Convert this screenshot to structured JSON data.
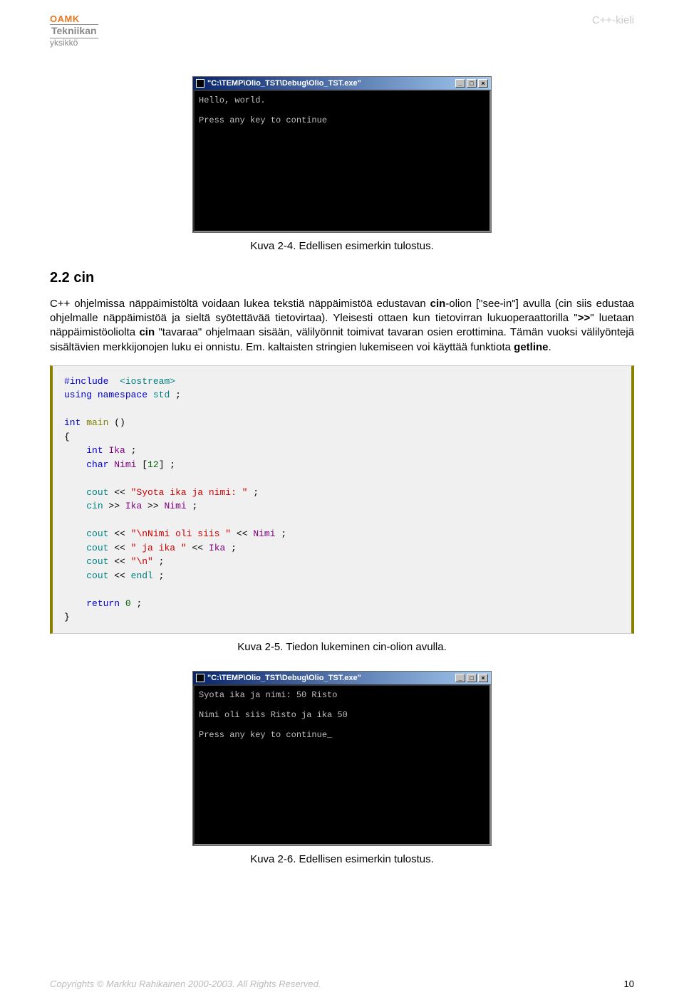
{
  "header": {
    "logo_top": "OAMK",
    "logo_mid": "Tekniikan",
    "logo_bot": "yksikkö",
    "page_label": "C++-kieli"
  },
  "console1": {
    "title": "\"C:\\TEMP\\Olio_TST\\Debug\\Olio_TST.exe\"",
    "line1": "Hello, world.",
    "line2": "Press any key to continue"
  },
  "caption1": "Kuva 2-4. Edellisen esimerkin tulostus.",
  "section_heading": "2.2 cin",
  "paragraph": {
    "p1a": "C++ ohjelmissa näppäimistöltä voidaan lukea tekstiä näppäimistöä edustavan ",
    "p1b": "cin",
    "p1c": "-olion [\"see-in\"] avulla (cin siis edustaa ohjelmalle näppäimistöä ja sieltä syötettävää tietovirtaa). Yleisesti ottaen kun tietovirran lukuoperaattorilla \"",
    "p1d": ">>",
    "p1e": "\" luetaan näppäimistöoliolta ",
    "p1f": "cin",
    "p1g": " \"tavaraa\" ohjelmaan sisään, välilyönnit toimivat tavaran osien erottimina. Tämän vuoksi välilyöntejä sisältävien merkkijonojen luku ei onnistu. Em. kaltaisten stringien lukemiseen voi käyttää funktiota ",
    "p1h": "getline",
    "p1i": "."
  },
  "code": {
    "l1a": "#include",
    "l1b": "<iostream>",
    "l2a": "using",
    "l2b": "namespace",
    "l2c": "std",
    "l3a": "int",
    "l3b": "main",
    "l4a": "int",
    "l4b": "Ika",
    "l5a": "char",
    "l5b": "Nimi",
    "l5c": "12",
    "l6a": "cout",
    "l6b": "\"Syota ika ja nimi: \"",
    "l7a": "cin",
    "l7b": "Ika",
    "l7c": "Nimi",
    "l8a": "cout",
    "l8b": "\"\\nNimi oli siis \"",
    "l8c": "Nimi",
    "l9a": "cout",
    "l9b": "\" ja ika \"",
    "l9c": "Ika",
    "l10a": "cout",
    "l10b": "\"\\n\"",
    "l11a": "cout",
    "l11b": "endl",
    "l12a": "return",
    "l12b": "0"
  },
  "caption2": "Kuva 2-5. Tiedon lukeminen cin-olion avulla.",
  "console2": {
    "title": "\"C:\\TEMP\\Olio_TST\\Debug\\Olio_TST.exe\"",
    "line1": "Syota ika ja nimi: 50 Risto",
    "line2": "Nimi oli siis Risto ja ika 50",
    "line3": "Press any key to continue_"
  },
  "caption3": "Kuva 2-6. Edellisen esimerkin tulostus.",
  "footer": {
    "copyright": "Copyrights © Markku Rahikainen 2000-2003. All Rights Reserved.",
    "page_number": "10"
  }
}
